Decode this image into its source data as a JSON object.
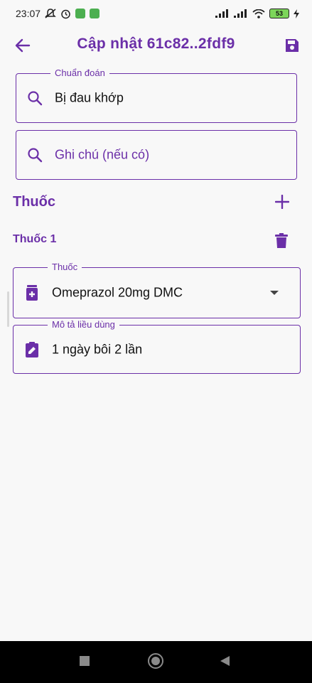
{
  "status_bar": {
    "time": "23:07",
    "battery": "53",
    "icons": [
      "muted-notification-icon",
      "alarm-icon",
      "app-icon",
      "app-icon",
      "signal-icon",
      "signal-icon",
      "wifi-icon",
      "battery-icon",
      "charging-icon"
    ]
  },
  "app_bar": {
    "title": "Cập nhật 61c82..2fdf9",
    "back_icon": "arrow-left-icon",
    "save_icon": "save-icon"
  },
  "diagnosis": {
    "label": "Chuẩn đoán",
    "value": "Bị đau khớp",
    "icon": "search-icon"
  },
  "note": {
    "placeholder": "Ghi chú (nếu có)",
    "icon": "search-icon"
  },
  "medicine_section": {
    "title": "Thuốc",
    "add_icon": "plus-icon"
  },
  "medicine_item": {
    "title": "Thuốc 1",
    "delete_icon": "trash-icon",
    "drug_label": "Thuốc",
    "drug_value": "Omeprazol 20mg DMC",
    "drug_icon": "medication-icon",
    "dosage_label": "Mô tả liều dùng",
    "dosage_value": "1 ngày bôi 2 lần",
    "dosage_icon": "clipboard-edit-icon"
  },
  "colors": {
    "accent": "#6b2fa8",
    "background": "#f8f8f8",
    "nav_bar": "#000000"
  }
}
